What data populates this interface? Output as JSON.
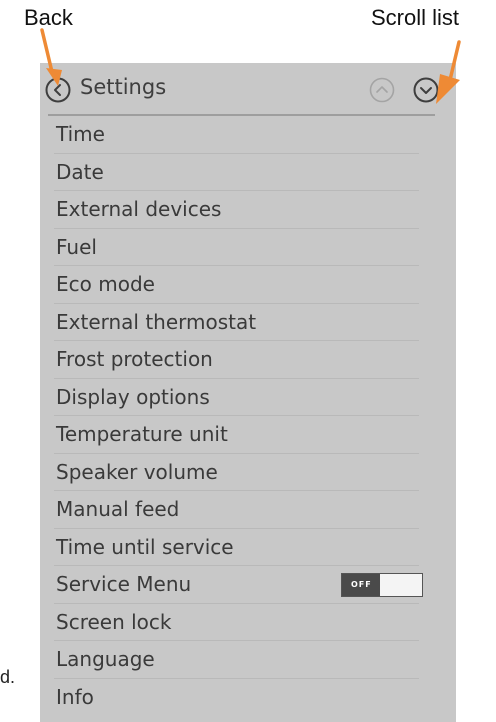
{
  "annotations": {
    "back_label": "Back",
    "scroll_label": "Scroll list",
    "stray_text": "d.",
    "arrow_color": "#ee8a35"
  },
  "header": {
    "title": "Settings",
    "back_icon": "chevron-left-circle-icon",
    "scroll_up_icon": "chevron-up-circle-icon",
    "scroll_down_icon": "chevron-down-circle-icon"
  },
  "menu": {
    "items": [
      {
        "label": "Time"
      },
      {
        "label": "Date"
      },
      {
        "label": "External devices"
      },
      {
        "label": "Fuel"
      },
      {
        "label": "Eco mode"
      },
      {
        "label": "External thermostat"
      },
      {
        "label": "Frost protection"
      },
      {
        "label": "Display options"
      },
      {
        "label": "Temperature unit"
      },
      {
        "label": "Speaker volume"
      },
      {
        "label": "Manual feed"
      },
      {
        "label": "Time until service"
      },
      {
        "label": "Service Menu",
        "toggle": {
          "text": "OFF",
          "state": "off"
        }
      },
      {
        "label": "Screen lock"
      },
      {
        "label": "Language"
      },
      {
        "label": "Info"
      }
    ]
  },
  "colors": {
    "panel_bg": "#c8c8c8",
    "text": "#3a3a3a",
    "arrow": "#ee8a35"
  }
}
